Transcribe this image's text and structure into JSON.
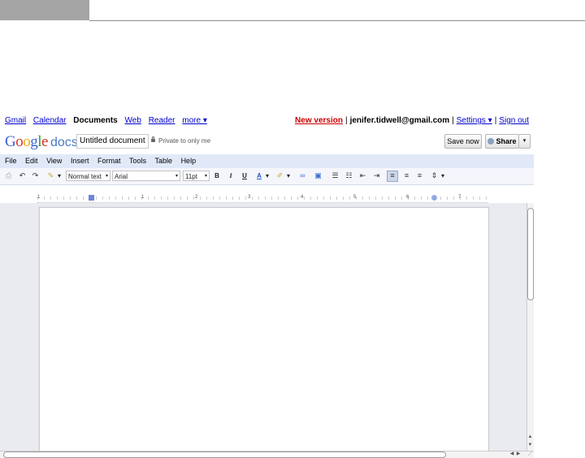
{
  "topnav": {
    "left": [
      "Gmail",
      "Calendar",
      "Documents",
      "Web",
      "Reader",
      "more ▾"
    ],
    "new_version": "New version",
    "email": "jenifer.tidwell@gmail.com",
    "settings": "Settings ▾",
    "sign_out": "Sign out",
    "sep": "|"
  },
  "titlebar": {
    "logo_docs": "docs",
    "doc_title": "Untitled document",
    "privacy": "Private to only me",
    "save_label": "Save now",
    "share_label": "Share",
    "share_arrow": "▾"
  },
  "menu": [
    "File",
    "Edit",
    "View",
    "Insert",
    "Format",
    "Tools",
    "Table",
    "Help"
  ],
  "toolbar": {
    "style_value": "Normal text",
    "font_value": "Arial",
    "size_value": "11pt",
    "bold": "B",
    "italic": "I",
    "underline": "U",
    "text_color": "A",
    "dropdown_arrow": "▾"
  },
  "ruler": {
    "numbers": [
      "1",
      "1",
      "2",
      "3",
      "4",
      "5",
      "6",
      "7"
    ]
  },
  "scroll": {
    "up": "▲",
    "down": "▼",
    "left": "◀",
    "right": "▶"
  },
  "colors": {
    "menu_bg": "#e1e9f9",
    "link": "#0000cc",
    "new_version": "#cc0000"
  }
}
